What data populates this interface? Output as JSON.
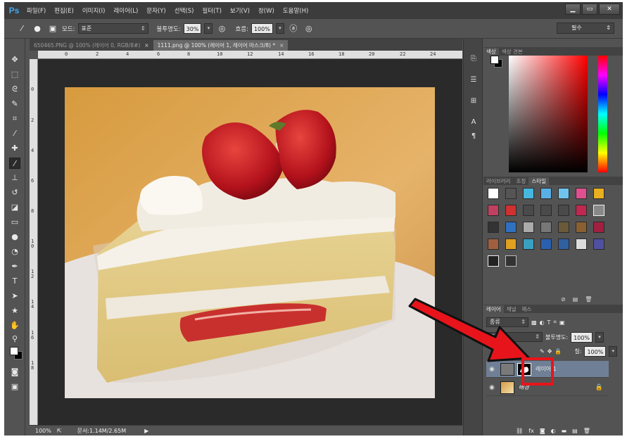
{
  "app": {
    "logo": "Ps"
  },
  "menubar": {
    "items": [
      "파일(F)",
      "편집(E)",
      "이미지(I)",
      "레이어(L)",
      "문자(Y)",
      "선택(S)",
      "필터(T)",
      "보기(V)",
      "창(W)",
      "도움말(H)"
    ],
    "window_controls": {
      "minimize": "▁",
      "restore": "▭",
      "close": "✕"
    }
  },
  "options": {
    "mode_label": "모드:",
    "mode_value": "표준",
    "opacity_label": "불투명도:",
    "opacity_value": "30%",
    "flow_label": "흐름:",
    "flow_value": "100%",
    "workspace": "필수"
  },
  "tabs": [
    {
      "label": "650465.PNG @ 100% (레이어 0, RGB/8#)",
      "close": "×",
      "active": false
    },
    {
      "label": "1111.png @ 100% (레이어 1, 레이어 마스크/8) *",
      "close": "×",
      "active": true
    }
  ],
  "ruler": {
    "h_ticks": [
      "0",
      "2",
      "4",
      "6",
      "8",
      "10",
      "12",
      "14",
      "16",
      "18",
      "20",
      "22",
      "24"
    ],
    "v_ticks": [
      "0",
      "2",
      "4",
      "6",
      "8",
      "1 0",
      "1 2",
      "1 4",
      "1 6",
      "1 8"
    ]
  },
  "status": {
    "zoom": "100%",
    "doc": "문서:1.14M/2.65M"
  },
  "color_panel": {
    "tabs": [
      "색상",
      "색상 견본"
    ],
    "accent_red": "#e8141b"
  },
  "styles_panel": {
    "tabs": [
      "라이브러리",
      "조정",
      "스타일"
    ]
  },
  "layers_panel": {
    "tabs": [
      "레이어",
      "채널",
      "패스"
    ],
    "kind_label": "종류",
    "blend_mode": "표준",
    "opacity_label": "불투명도:",
    "opacity_value": "100%",
    "fill_label": "칠:",
    "fill_value": "100%",
    "layers": [
      {
        "name": "레이어 1",
        "selected": true
      },
      {
        "name": "배경",
        "selected": false
      }
    ]
  }
}
